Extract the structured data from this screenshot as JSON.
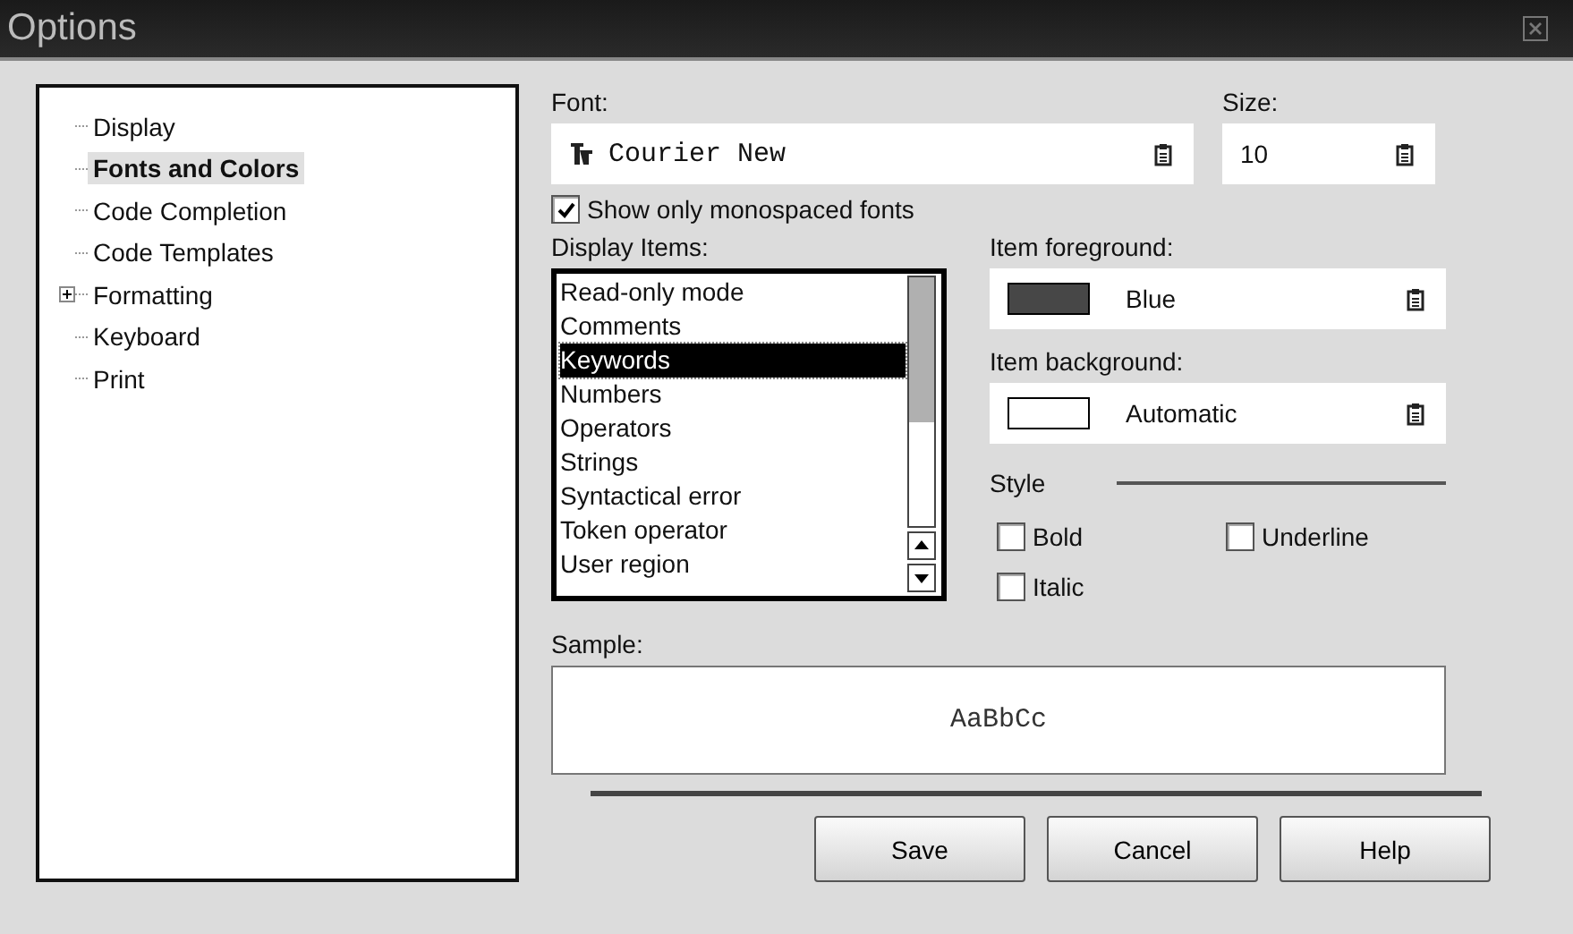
{
  "window": {
    "title": "Options"
  },
  "tree": [
    {
      "label": "Display",
      "kind": "leaf",
      "selected": false
    },
    {
      "label": "Fonts and Colors",
      "kind": "leaf",
      "selected": true
    },
    {
      "label": "Code Completion",
      "kind": "leaf",
      "selected": false
    },
    {
      "label": "Code Templates",
      "kind": "leaf",
      "selected": false
    },
    {
      "label": "Formatting",
      "kind": "collapsed",
      "selected": false
    },
    {
      "label": "Keyboard",
      "kind": "leaf",
      "selected": false
    },
    {
      "label": "Print",
      "kind": "leaf",
      "selected": false
    }
  ],
  "font": {
    "label": "Font:",
    "value": "Courier New"
  },
  "size": {
    "label": "Size:",
    "value": "10"
  },
  "monospaced": {
    "label": "Show only monospaced fonts",
    "checked": true
  },
  "display_items": {
    "label": "Display Items:",
    "items": [
      {
        "label": "Read-only mode",
        "selected": false
      },
      {
        "label": "Comments",
        "selected": false
      },
      {
        "label": "Keywords",
        "selected": true
      },
      {
        "label": "Numbers",
        "selected": false
      },
      {
        "label": "Operators",
        "selected": false
      },
      {
        "label": "Strings",
        "selected": false
      },
      {
        "label": "Syntactical error",
        "selected": false
      },
      {
        "label": "Token operator",
        "selected": false
      },
      {
        "label": "User region",
        "selected": false
      }
    ]
  },
  "foreground": {
    "label": "Item foreground:",
    "value": "Blue",
    "color": "#474747"
  },
  "background": {
    "label": "Item background:",
    "value": "Automatic",
    "color": "#ffffff"
  },
  "style": {
    "label": "Style",
    "options": [
      {
        "label": "Bold",
        "checked": false
      },
      {
        "label": "Underline",
        "checked": false
      },
      {
        "label": "Italic",
        "checked": false
      }
    ]
  },
  "sample": {
    "label": "Sample:",
    "text": "AaBbCc"
  },
  "buttons": [
    "Save",
    "Cancel",
    "Help"
  ]
}
